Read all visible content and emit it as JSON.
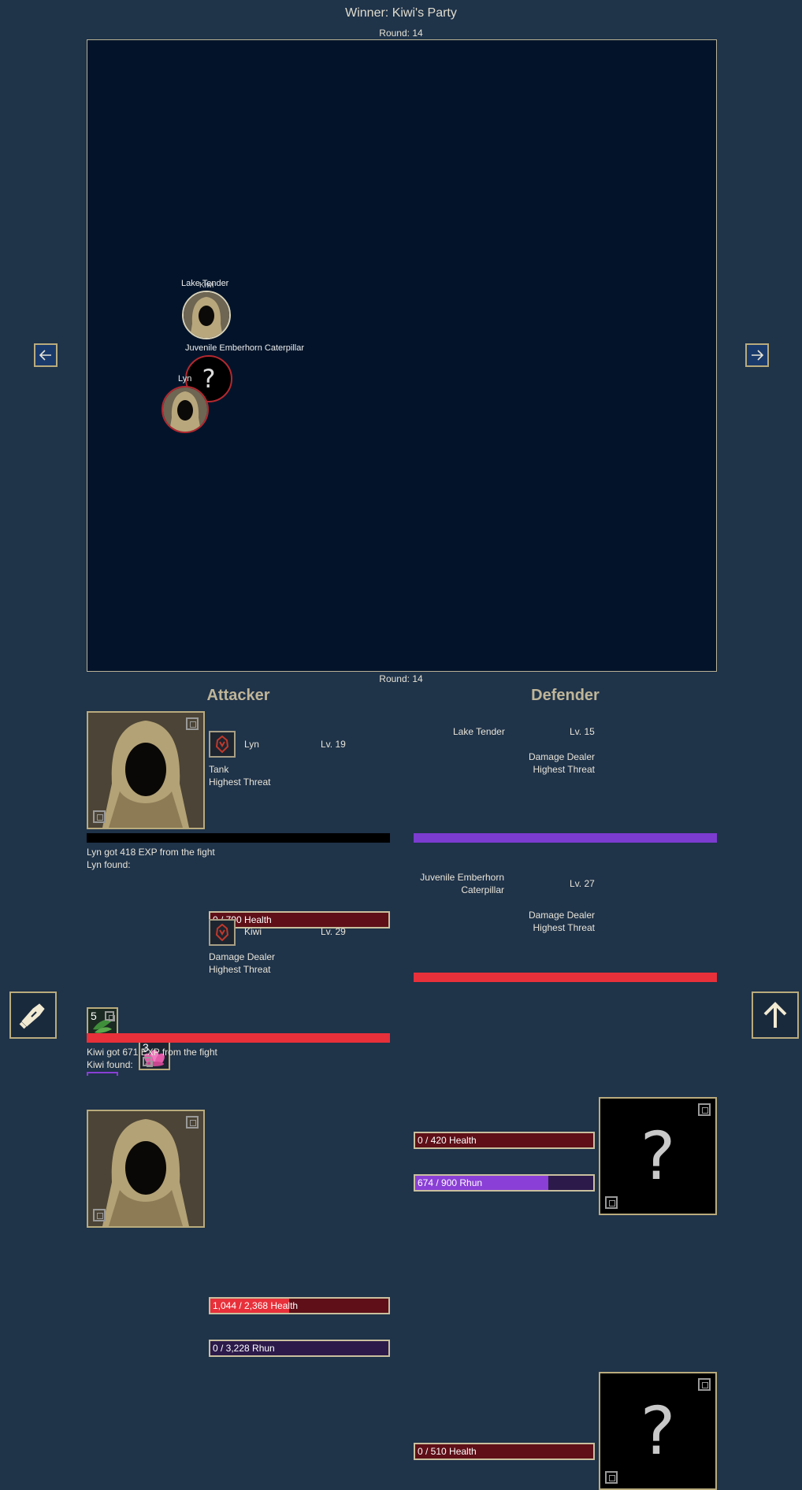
{
  "header": {
    "title": "Winner: Kiwi's Party",
    "round_top": "Round: 14",
    "round_bottom": "Round: 14"
  },
  "arena": {
    "tokens": [
      {
        "name": "Lake Tender",
        "overlap_label": "Kiwi"
      },
      {
        "name": "Juvenile Emberhorn Caterpillar",
        "glyph": "?"
      },
      {
        "name": "Lyn"
      }
    ]
  },
  "nav": {
    "prev_icon": "arrow-left-icon",
    "next_icon": "arrow-right-icon"
  },
  "attacker": {
    "heading": "Attacker",
    "members": [
      {
        "name": "Lyn",
        "level": "Lv. 19",
        "role": "Tank",
        "threat": "Highest Threat",
        "health_text": "0 / 790 Health",
        "health_fraction": 0,
        "underbar_color": "#000000",
        "exp_text": "Lyn got 418 EXP from the fight",
        "found_text": "Lyn found:",
        "loot": [
          {
            "count": "5",
            "icon": "herb-leaf-icon"
          },
          {
            "count": "3",
            "icon": "lotus-flower-icon"
          }
        ]
      },
      {
        "name": "Kiwi",
        "level": "Lv. 29",
        "role": "Damage Dealer",
        "threat": "Highest Threat",
        "health_text": "1,044 / 2,368 Health",
        "health_fraction": 0.441,
        "rhun_text": "0 / 3,228 Rhun",
        "rhun_fraction": 0,
        "underbar_color": "#e8303a",
        "exp_text": "Kiwi got 671 EXP from the fight",
        "found_text": "Kiwi found:"
      }
    ]
  },
  "defender": {
    "heading": "Defender",
    "members": [
      {
        "name": "Lake Tender",
        "level": "Lv. 15",
        "role": "Damage Dealer",
        "threat": "Highest Threat",
        "health_text": "0 / 420 Health",
        "health_fraction": 0,
        "rhun_text": "674 / 900 Rhun",
        "rhun_fraction": 0.749,
        "underbar_color": "#7c3cd0",
        "portrait_glyph": "?"
      },
      {
        "name_line1": "Juvenile Emberhorn",
        "name_line2": "Caterpillar",
        "level": "Lv. 27",
        "role": "Damage Dealer",
        "threat": "Highest Threat",
        "health_text": "0 / 510 Health",
        "health_fraction": 0,
        "underbar_color": "#e8303a",
        "portrait_glyph": "?"
      }
    ]
  },
  "side_buttons": {
    "left_icon": "scroll-hand-icon",
    "right_icon": "arrow-up-icon"
  },
  "colors": {
    "background": "#1f3349",
    "arena": "#03142a",
    "health_empty": "#5e0f17",
    "health_fill": "#e8303a",
    "rhun_empty": "#2b1a4a",
    "rhun_fill": "#8a3fd6",
    "frame": "#b9ab7d"
  }
}
